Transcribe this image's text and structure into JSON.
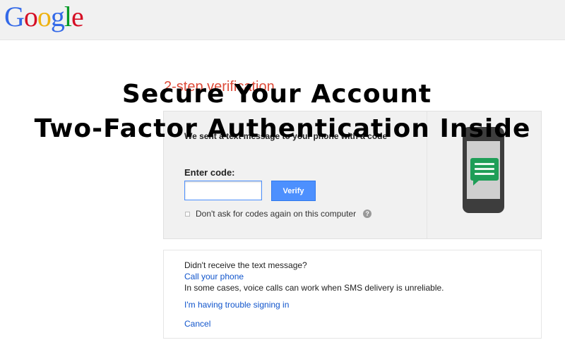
{
  "header": {
    "logo_letters": [
      {
        "char": "G",
        "color": "#3369e8"
      },
      {
        "char": "o",
        "color": "#d50f25"
      },
      {
        "char": "o",
        "color": "#eeb211"
      },
      {
        "char": "g",
        "color": "#3369e8"
      },
      {
        "char": "l",
        "color": "#009925"
      },
      {
        "char": "e",
        "color": "#d50f25"
      }
    ]
  },
  "page_title": "2-step verification",
  "verify_panel": {
    "sent_message": "We sent a text message to your phone with a code",
    "enter_code_label": "Enter code:",
    "code_input_value": "",
    "code_input_placeholder": "",
    "verify_button_label": "Verify",
    "remember_label": "Don't ask for codes again on this computer",
    "remember_checked": false,
    "help_icon_glyph": "?",
    "phone_illustration": "phone-sms-icon"
  },
  "help_section": {
    "not_received_text": "Didn't receive the text message?",
    "call_link": "Call your phone",
    "voice_call_note": "In some cases, voice calls can work when SMS delivery is unreliable.",
    "trouble_link": "I'm having trouble signing in",
    "cancel_link": "Cancel"
  },
  "overlay": {
    "line1": "Secure Your Account",
    "line2": "Two-Factor Authentication Inside"
  },
  "colors": {
    "accent_blue": "#4d90fe",
    "link_blue": "#1155cc",
    "title_red": "#dd4b39",
    "sms_green": "#1e9e57"
  }
}
